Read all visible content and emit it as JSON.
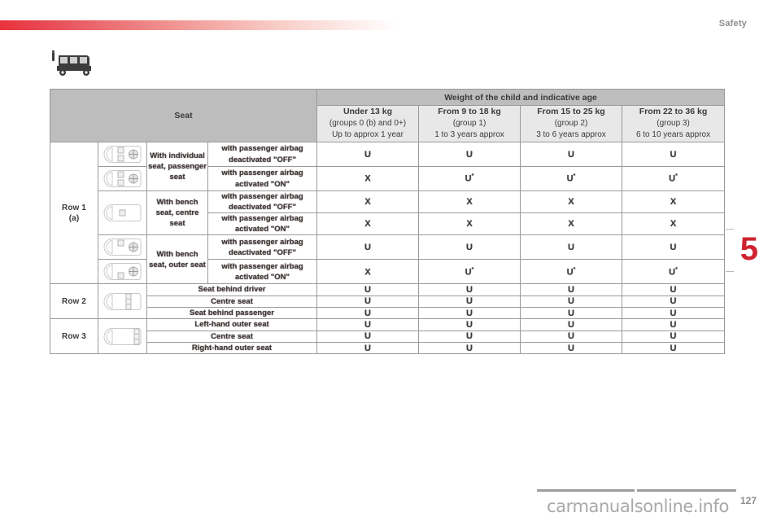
{
  "header": {
    "chapter_label": "Safety",
    "chapter_number": "5",
    "page_number": "127"
  },
  "watermark": {
    "text": "carmanualsonline.info"
  },
  "section_icon": "child-seat-vehicle-icon",
  "table": {
    "seat_header": "Seat",
    "weight_header": "Weight of the child and indicative age",
    "weight_columns": [
      {
        "weight": "Under 13 kg",
        "group": "(groups 0 (b) and 0+)",
        "age": "Up to approx 1 year"
      },
      {
        "weight": "From 9 to 18 kg",
        "group": "(group 1)",
        "age": "1 to 3 years approx"
      },
      {
        "weight": "From 15 to 25 kg",
        "group": "(group 2)",
        "age": "3 to 6 years approx"
      },
      {
        "weight": "From 22 to 36 kg",
        "group": "(group 3)",
        "age": "6 to 10 years approx"
      }
    ],
    "row_groups": [
      {
        "label": "Row 1",
        "note": "(a)",
        "icon": "vehicle-top-view-front-seats",
        "rows": [
          {
            "seat_type": "With individual seat, passenger seat",
            "airbag": "with passenger airbag deactivated \"OFF\"",
            "values": [
              "U",
              "U",
              "U",
              "U"
            ],
            "sups": [
              "",
              "",
              "",
              ""
            ]
          },
          {
            "seat_type": "",
            "airbag": "with passenger airbag activated \"ON\"",
            "values": [
              "X",
              "U",
              "U",
              "U"
            ],
            "sups": [
              "",
              "*",
              "*",
              "*"
            ]
          },
          {
            "seat_type": "With bench seat, centre seat",
            "airbag": "with passenger airbag deactivated \"OFF\"",
            "values": [
              "X",
              "X",
              "X",
              "X"
            ],
            "sups": [
              "",
              "",
              "",
              ""
            ]
          },
          {
            "seat_type": "",
            "airbag": "with passenger airbag activated \"ON\"",
            "values": [
              "X",
              "X",
              "X",
              "X"
            ],
            "sups": [
              "",
              "",
              "",
              ""
            ]
          },
          {
            "seat_type": "With bench seat, outer seat",
            "airbag": "with passenger airbag deactivated \"OFF\"",
            "values": [
              "U",
              "U",
              "U",
              "U"
            ],
            "sups": [
              "",
              "",
              "",
              ""
            ]
          },
          {
            "seat_type": "",
            "airbag": "with passenger airbag activated \"ON\"",
            "values": [
              "X",
              "U",
              "U",
              "U"
            ],
            "sups": [
              "",
              "*",
              "*",
              "*"
            ]
          }
        ]
      },
      {
        "label": "Row 2",
        "note": "",
        "icon": "vehicle-top-view-second-row",
        "rows": [
          {
            "seat_type": "Seat behind driver",
            "airbag": "",
            "values": [
              "U",
              "U",
              "U",
              "U"
            ],
            "sups": [
              "",
              "",
              "",
              ""
            ]
          },
          {
            "seat_type": "Centre seat",
            "airbag": "",
            "values": [
              "U",
              "U",
              "U",
              "U"
            ],
            "sups": [
              "",
              "",
              "",
              ""
            ]
          },
          {
            "seat_type": "Seat behind passenger",
            "airbag": "",
            "values": [
              "U",
              "U",
              "U",
              "U"
            ],
            "sups": [
              "",
              "",
              "",
              ""
            ]
          }
        ]
      },
      {
        "label": "Row 3",
        "note": "",
        "icon": "vehicle-top-view-third-row",
        "rows": [
          {
            "seat_type": "Left-hand outer seat",
            "airbag": "",
            "values": [
              "U",
              "U",
              "U",
              "U"
            ],
            "sups": [
              "",
              "",
              "",
              ""
            ]
          },
          {
            "seat_type": "Centre seat",
            "airbag": "",
            "values": [
              "U",
              "U",
              "U",
              "U"
            ],
            "sups": [
              "",
              "",
              "",
              ""
            ]
          },
          {
            "seat_type": "Right-hand outer seat",
            "airbag": "",
            "values": [
              "U",
              "U",
              "U",
              "U"
            ],
            "sups": [
              "",
              "",
              "",
              ""
            ]
          }
        ]
      }
    ]
  },
  "colors": {
    "accent_red": "#cf2430",
    "header_grey": "#bdbdbd",
    "subheader_grey": "#e8e8e8",
    "text_dark": "#3b3b3b"
  }
}
